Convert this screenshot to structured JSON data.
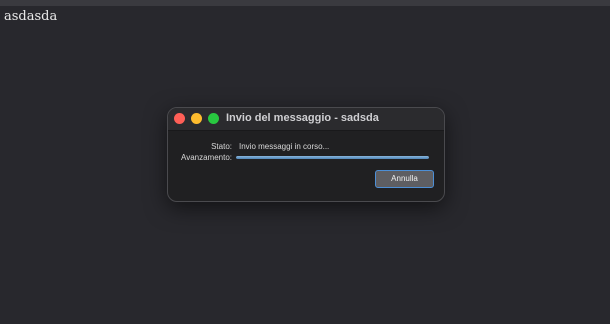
{
  "background": {
    "title": "asdasda"
  },
  "dialog": {
    "title": "Invio del messaggio - sadsda",
    "status_label": "Stato:",
    "status_value": "Invio messaggi in corso...",
    "progress_label": "Avanzamento:",
    "progress_fraction": 1.0,
    "cancel_label": "Annulla"
  },
  "colors": {
    "background": "#28282d",
    "dialog_bg": "#202022",
    "progress_fill": "#6a9fcd",
    "button_border": "#4d8fd6",
    "close": "#ff5f57",
    "minimize": "#febc2e",
    "maximize": "#28c840"
  }
}
